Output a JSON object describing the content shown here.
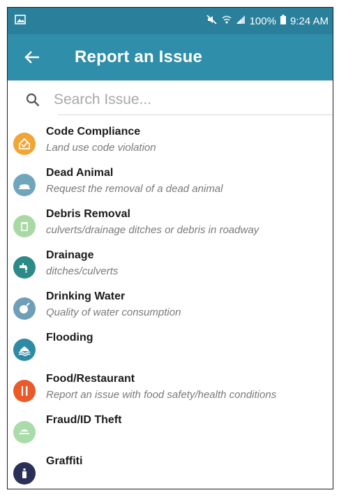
{
  "status_bar": {
    "battery": "100%",
    "time": "9:24 AM"
  },
  "app_bar": {
    "title": "Report an Issue"
  },
  "search": {
    "placeholder": "Search Issue..."
  },
  "issues": [
    {
      "title": "Code Compliance",
      "subtitle": "Land use code violation",
      "icon": "house-check-icon",
      "color": "#f0a535"
    },
    {
      "title": "Dead Animal",
      "subtitle": "Request the removal of a dead animal",
      "icon": "dead-animal-icon",
      "color": "#6fa6bd"
    },
    {
      "title": "Debris Removal",
      "subtitle": "culverts/drainage ditches or debris in roadway",
      "icon": "trash-icon",
      "color": "#a8d8a3"
    },
    {
      "title": "Drainage",
      "subtitle": "ditches/culverts",
      "icon": "faucet-icon",
      "color": "#2e8a88"
    },
    {
      "title": "Drinking Water",
      "subtitle": "Quality of water consumption",
      "icon": "water-glass-icon",
      "color": "#6e9eb8"
    },
    {
      "title": "Flooding",
      "subtitle": "",
      "icon": "flood-house-icon",
      "color": "#2f8aa3"
    },
    {
      "title": "Food/Restaurant",
      "subtitle": "Report an issue with food safety/health conditions",
      "icon": "fork-knife-icon",
      "color": "#ea5a2b"
    },
    {
      "title": "Fraud/ID Theft",
      "subtitle": "",
      "icon": "id-card-icon",
      "color": "#a9dca8"
    },
    {
      "title": "Graffiti",
      "subtitle": "",
      "icon": "spray-can-icon",
      "color": "#2a2f57"
    }
  ]
}
